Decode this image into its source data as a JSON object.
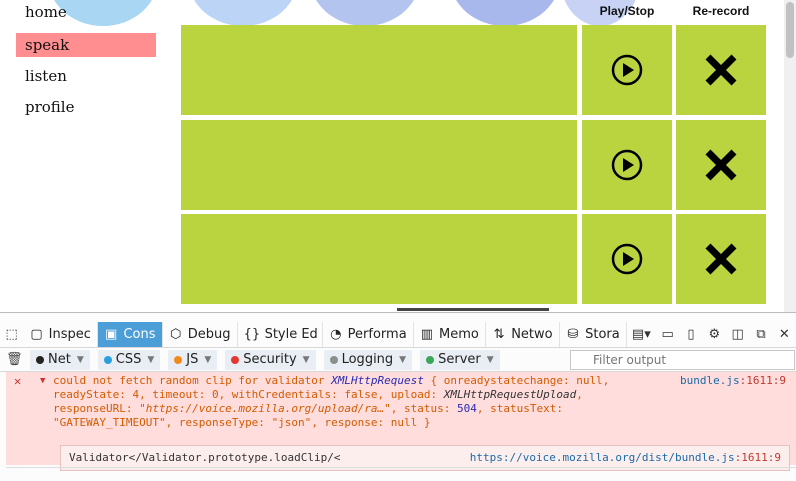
{
  "nav": {
    "items": [
      {
        "label": "home"
      },
      {
        "label": "speak",
        "active": true
      },
      {
        "label": "listen"
      },
      {
        "label": "profile"
      }
    ]
  },
  "columns": {
    "play": "Play/Stop",
    "rerecord": "Re-record"
  },
  "recordings": {
    "count": 3
  },
  "colors": {
    "clip_green": "#b9d43f",
    "active_nav": "#ff8e90",
    "devtools_active_tab": "#4c9ed9",
    "error_bg": "#ffdddd"
  },
  "devtools": {
    "tabs": [
      {
        "label": "Inspec",
        "icon": "inspector-icon"
      },
      {
        "label": "Cons",
        "icon": "console-icon",
        "active": true
      },
      {
        "label": "Debug",
        "icon": "debugger-icon"
      },
      {
        "label": "Style Ed",
        "icon": "style-editor-icon"
      },
      {
        "label": "Performa",
        "icon": "performance-icon"
      },
      {
        "label": "Memo",
        "icon": "memory-icon"
      },
      {
        "label": "Netwo",
        "icon": "network-icon"
      },
      {
        "label": "Stora",
        "icon": "storage-icon"
      }
    ],
    "filters": [
      {
        "label": "Net",
        "color": "#222222"
      },
      {
        "label": "CSS",
        "color": "#2b9fe0"
      },
      {
        "label": "JS",
        "color": "#f08a1f"
      },
      {
        "label": "Security",
        "color": "#e0392f"
      },
      {
        "label": "Logging",
        "color": "#8e8e8e"
      },
      {
        "label": "Server",
        "color": "#3aa856"
      }
    ],
    "filter_placeholder": "Filter output",
    "error": {
      "line1_pre": "could not fetch random clip for validator ",
      "line1_type": "XMLHttpRequest",
      "line1_post": " { onreadystatechange: null,",
      "line2": "readyState: 4, timeout: 0, withCredentials: false, upload: ",
      "line2_type": "XMLHttpRequestUpload",
      "line2_end": ",",
      "line3_pre": "responseURL: ",
      "line3_url": "\"https://voice.mozilla.org/upload/ra…\"",
      "line3_mid": ", status: ",
      "line3_status": "504",
      "line3_post": ", statusText:",
      "line4_str": "\"GATEWAY_TIMEOUT\"",
      "line4_mid": ", responseType: ",
      "line4_type": "\"json\"",
      "line4_post": ", response: null }",
      "location": "bundle.js",
      "location_line": ":1611:9",
      "stack": "Validator</Validator.prototype.loadClip/<",
      "stack_location": "https://voice.mozilla.org/dist/bundle.js",
      "stack_line": ":1611:9"
    }
  }
}
